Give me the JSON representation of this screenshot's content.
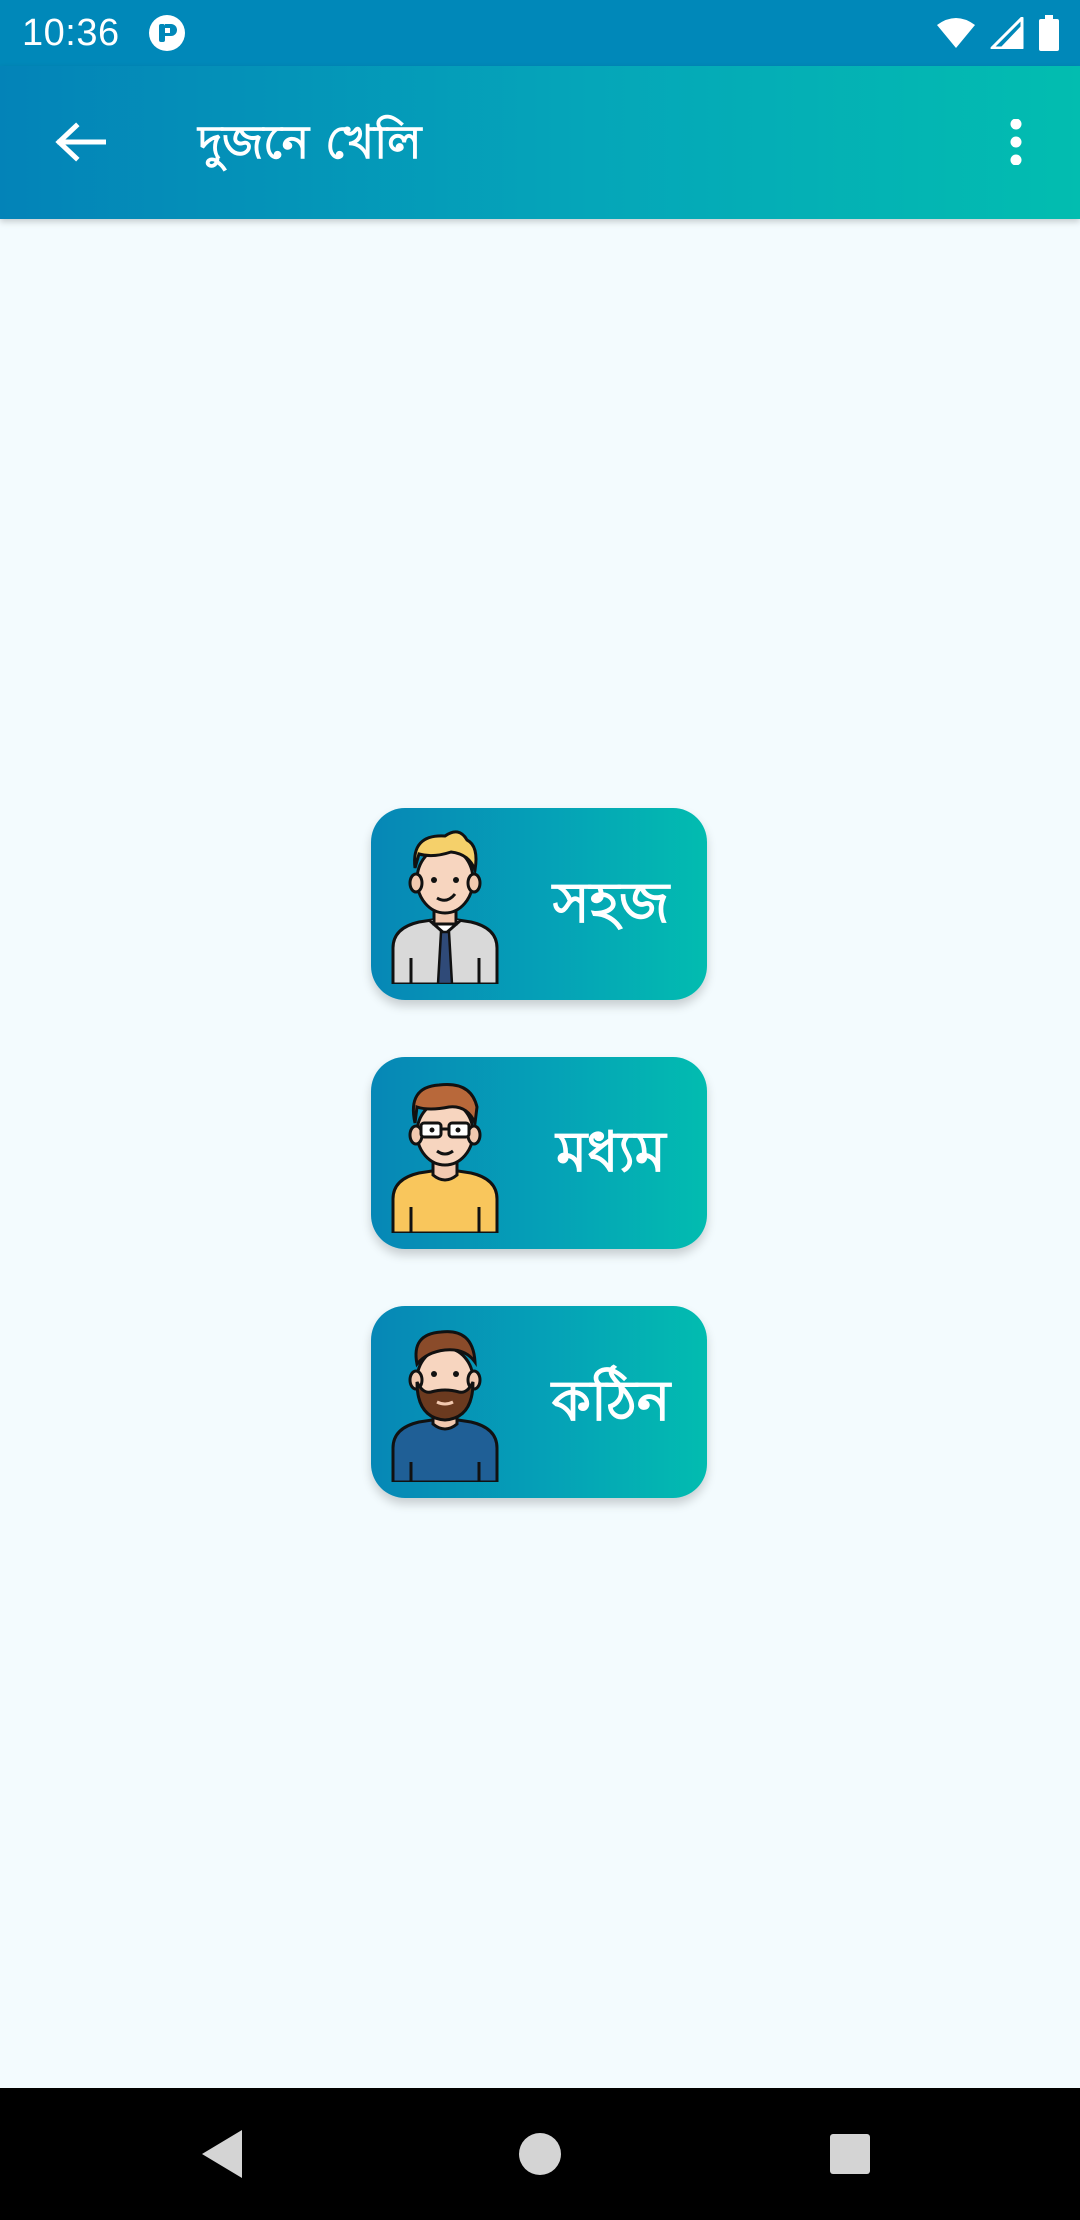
{
  "status_bar": {
    "time": "10:36",
    "icons": [
      "app-notification-icon",
      "wifi-icon",
      "signal-icon",
      "battery-icon"
    ]
  },
  "app_bar": {
    "title": "দুজনে খেলি",
    "back_icon": "arrow-back-icon",
    "menu_icon": "more-vert-icon"
  },
  "levels": [
    {
      "label": "সহজ",
      "avatar": "blond-man-tie-avatar"
    },
    {
      "label": "মধ্যম",
      "avatar": "glasses-man-avatar"
    },
    {
      "label": "কঠিন",
      "avatar": "bearded-man-avatar"
    }
  ],
  "colors": {
    "status_bar": "#0088b9",
    "gradient_start": "#0383b8",
    "gradient_end": "#02bdb0",
    "background": "#f3fbfe",
    "nav_bar": "#000000"
  },
  "nav_bar": {
    "icons": [
      "nav-back-icon",
      "nav-home-icon",
      "nav-recents-icon"
    ]
  }
}
